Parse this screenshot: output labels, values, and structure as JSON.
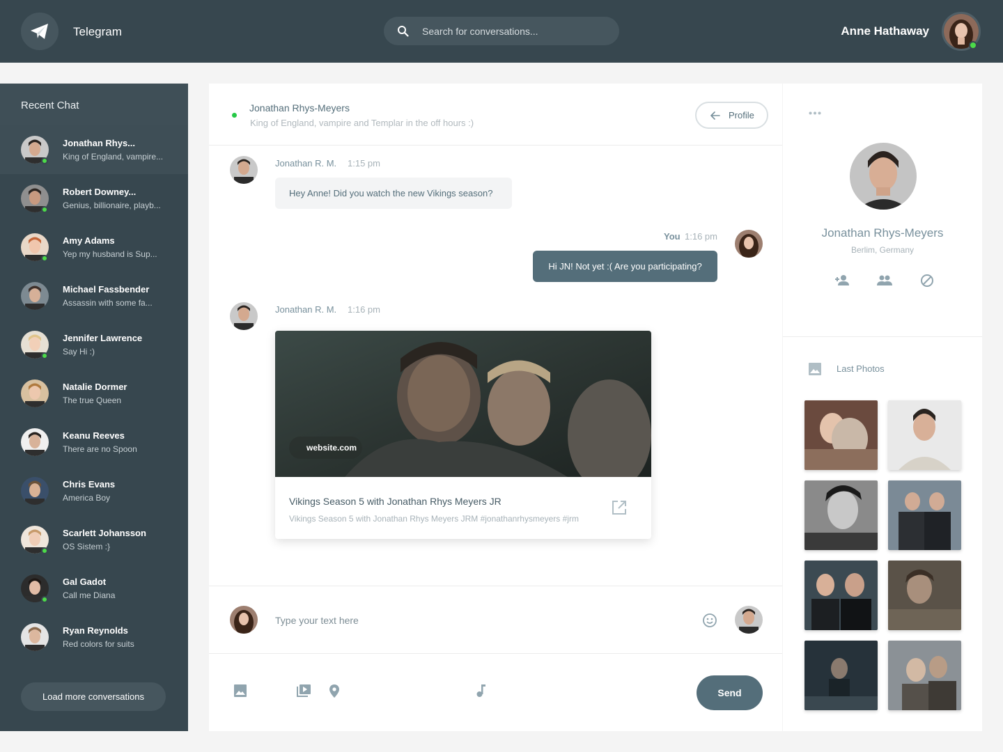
{
  "header": {
    "app_title": "Telegram",
    "search_placeholder": "Search for conversations...",
    "user_name": "Anne Hathaway"
  },
  "sidebar": {
    "title": "Recent Chat",
    "load_more_label": "Load more conversations",
    "chats": [
      {
        "name": "Jonathan Rhys...",
        "preview": "King of England, vampire...",
        "online": true,
        "active": true
      },
      {
        "name": "Robert Downey...",
        "preview": "Genius, billionaire, playb...",
        "online": true,
        "active": false
      },
      {
        "name": "Amy Adams",
        "preview": "Yep my husband is Sup...",
        "online": true,
        "active": false
      },
      {
        "name": "Michael Fassbender",
        "preview": "Assassin with some fa...",
        "online": false,
        "active": false
      },
      {
        "name": "Jennifer Lawrence",
        "preview": "Say Hi :)",
        "online": true,
        "active": false
      },
      {
        "name": "Natalie Dormer",
        "preview": "The true Queen",
        "online": false,
        "active": false
      },
      {
        "name": "Keanu Reeves",
        "preview": "There are no Spoon",
        "online": false,
        "active": false
      },
      {
        "name": "Chris Evans",
        "preview": "America Boy",
        "online": false,
        "active": false
      },
      {
        "name": "Scarlett Johansson",
        "preview": "OS Sistem :}",
        "online": true,
        "active": false
      },
      {
        "name": "Gal Gadot",
        "preview": "Call me Diana",
        "online": true,
        "active": false
      },
      {
        "name": "Ryan Reynolds",
        "preview": "Red colors for suits",
        "online": false,
        "active": false
      }
    ]
  },
  "chat": {
    "contact_name": "Jonathan Rhys-Meyers",
    "contact_status": "King of England, vampire and Templar in the off hours :)",
    "profile_button_label": "Profile",
    "messages": [
      {
        "author": "Jonathan R. M.",
        "time": "1:15 pm",
        "text": "Hey Anne! Did you watch the new Vikings season?"
      },
      {
        "author": "You",
        "time": "1:16 pm",
        "text": "Hi JN! Not yet :( Are you participating?"
      },
      {
        "author": "Jonathan R. M.",
        "time": "1:16 pm"
      }
    ],
    "link_preview": {
      "site": "website.com",
      "title": "Vikings Season 5 with Jonathan Rhys Meyers JR",
      "description": "Vikings Season 5 with Jonathan Rhys Meyers JRM #jonathanrhysmeyers #jrm"
    },
    "compose_placeholder": "Type your text here",
    "send_label": "Send"
  },
  "profile_panel": {
    "name": "Jonathan Rhys-Meyers",
    "location": "Berlim, Germany",
    "photos_title": "Last Photos"
  },
  "colors": {
    "topbar": "#37474f",
    "sidebar": "#37474f",
    "accent": "#546e7a",
    "online": "#4cdb49"
  }
}
